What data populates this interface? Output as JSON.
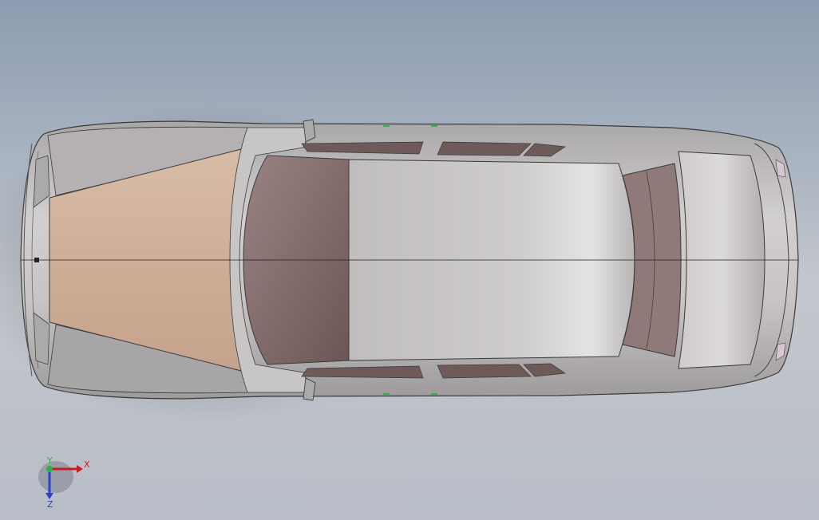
{
  "viewport": {
    "background_top": "#8d9cb0",
    "background_bottom": "#bcc1c9"
  },
  "model": {
    "body_color": "#bdb8b7",
    "hood_color": "#d2b29c",
    "glass_color": "#856c6c",
    "outline_color": "#3a3a3a"
  },
  "triad": {
    "x_label": "X",
    "y_label": "Y",
    "z_label": "Z",
    "x_color": "#c42020",
    "y_color": "#2bb34a",
    "z_color": "#2b44c4"
  }
}
